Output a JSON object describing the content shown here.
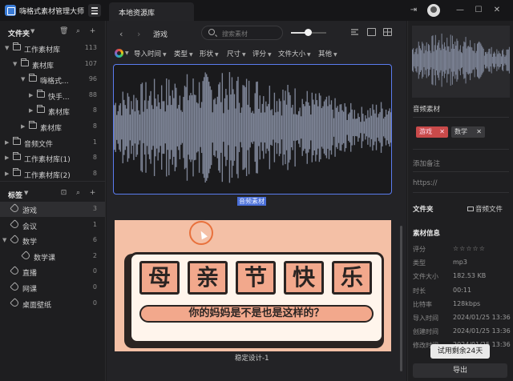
{
  "app": {
    "title": "嗨格式素材管理大师",
    "tab": "本地资源库"
  },
  "sidebar": {
    "folders_title": "文件夹",
    "folders": [
      {
        "label": "工作素材库",
        "count": "113",
        "level": 0,
        "expanded": true
      },
      {
        "label": "素材库",
        "count": "107",
        "level": 1,
        "expanded": true
      },
      {
        "label": "嗨格式...",
        "count": "96",
        "level": 2,
        "expanded": true
      },
      {
        "label": "快手...",
        "count": "88",
        "level": 3,
        "expanded": false
      },
      {
        "label": "素材库",
        "count": "8",
        "level": 3,
        "expanded": false
      },
      {
        "label": "素材库",
        "count": "8",
        "level": 2,
        "expanded": false
      },
      {
        "label": "音频文件",
        "count": "1",
        "level": 0,
        "expanded": false
      },
      {
        "label": "工作素材库(1)",
        "count": "8",
        "level": 0,
        "expanded": false
      },
      {
        "label": "工作素材库(2)",
        "count": "8",
        "level": 0,
        "expanded": false
      }
    ],
    "tags_title": "标签",
    "tags": [
      {
        "label": "游戏",
        "count": "3",
        "level": 0,
        "selected": true
      },
      {
        "label": "会议",
        "count": "1",
        "level": 0
      },
      {
        "label": "数学",
        "count": "6",
        "level": 0
      },
      {
        "label": "数学课",
        "count": "2",
        "level": 1
      },
      {
        "label": "直播",
        "count": "0",
        "level": 0
      },
      {
        "label": "网课",
        "count": "0",
        "level": 0
      },
      {
        "label": "桌面壁纸",
        "count": "0",
        "level": 0
      }
    ]
  },
  "toolbar": {
    "breadcrumb": "游戏",
    "search_placeholder": "搜索素材",
    "zoom_level": 0.4
  },
  "filters": [
    "导入时间",
    "类型",
    "形状",
    "尺寸",
    "评分",
    "文件大小",
    "其他"
  ],
  "assets": [
    {
      "name": "音频素材"
    },
    {
      "name": "稳定设计-1"
    }
  ],
  "poster": {
    "chars": [
      "母",
      "亲",
      "节",
      "快",
      "乐"
    ],
    "subtitle": "你的妈妈是不是也是这样的？"
  },
  "details": {
    "name": "音频素材",
    "tags": [
      "游戏",
      "数学"
    ],
    "note_placeholder": "添加备注",
    "url_placeholder": "https://",
    "folder_label": "文件夹",
    "folder_value": "音频文件",
    "info_title": "素材信息",
    "rows": [
      {
        "k": "评分",
        "v": "☆☆☆☆☆"
      },
      {
        "k": "类型",
        "v": "mp3"
      },
      {
        "k": "文件大小",
        "v": "182.53 KB"
      },
      {
        "k": "时长",
        "v": "00:11"
      },
      {
        "k": "比特率",
        "v": "128kbps"
      },
      {
        "k": "导入时间",
        "v": "2024/01/25 13:36"
      },
      {
        "k": "创建时间",
        "v": "2024/01/25 13:36"
      },
      {
        "k": "修改时间",
        "v": "2024/01/25 13:36"
      }
    ],
    "trial": "试用剩余24天",
    "export": "导出"
  },
  "colors": {
    "accent": "#5b7cf0",
    "tag_game": "#c94a4a",
    "tag_math": "#3a3a3d",
    "poster_bg": "#f4c0a6"
  }
}
